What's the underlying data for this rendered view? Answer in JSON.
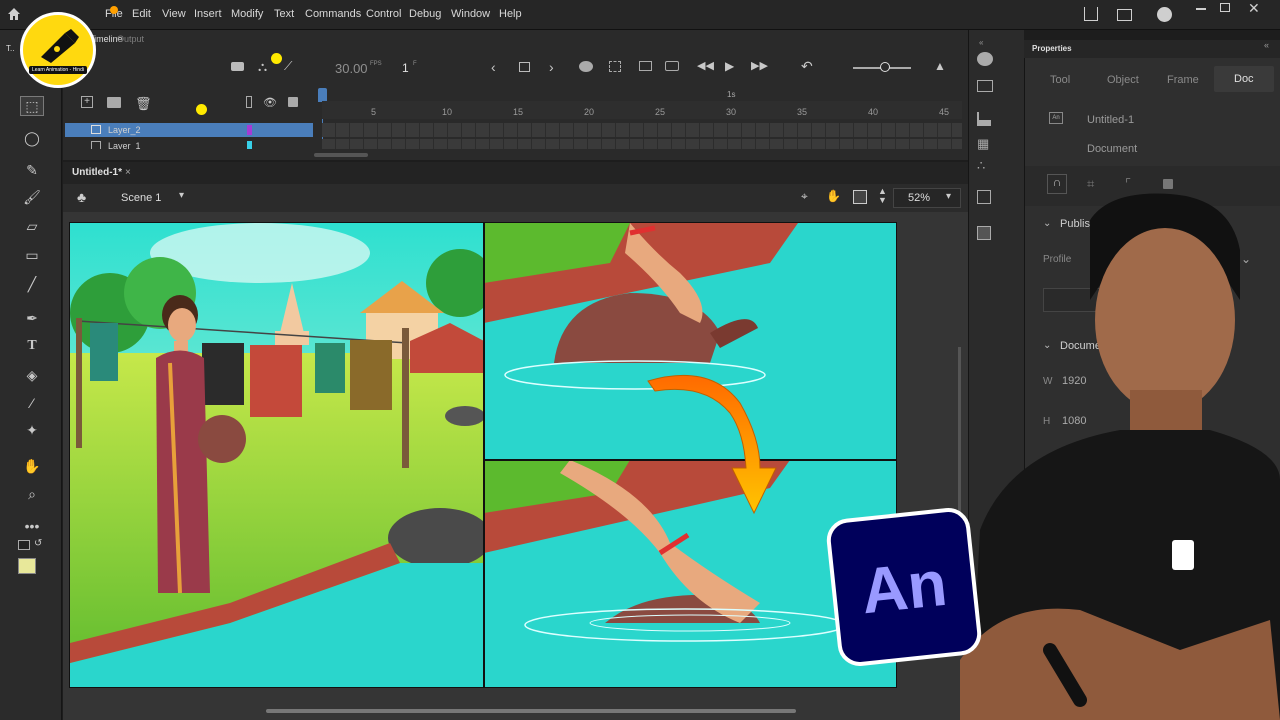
{
  "menu": [
    "File",
    "Edit",
    "View",
    "Insert",
    "Modify",
    "Text",
    "Commands",
    "Control",
    "Debug",
    "Window",
    "Help"
  ],
  "timeline": {
    "tab_timeline": "Timeline",
    "tab_output": "Output",
    "fps": "30.00",
    "fps_unit": "FPS",
    "frame": "1",
    "frame_unit": "F",
    "time_marker": "1s",
    "ticks": [
      "5",
      "10",
      "15",
      "20",
      "25",
      "30",
      "35",
      "40",
      "45"
    ],
    "layers": [
      {
        "name": "Layer_2",
        "color": "#a53bd6",
        "selected": true
      },
      {
        "name": "Layer_1",
        "color": "#38d0e8",
        "selected": false
      }
    ]
  },
  "document": {
    "tab": "Untitled-1*",
    "scene": "Scene 1",
    "zoom": "52%"
  },
  "channel_badge": {
    "text": "Learn Animation - Hindi"
  },
  "properties": {
    "title": "Properties",
    "tabs": [
      "Tool",
      "Object",
      "Frame",
      "Doc"
    ],
    "active_tab": "Doc",
    "doc_name": "Untitled-1",
    "doc_type": "Document",
    "section_publish": "Publish S",
    "profile_label": "Profile",
    "section_document": "Docume",
    "width_label": "W",
    "width_value": "1920",
    "height_label": "H",
    "height_value": "1080"
  },
  "logo": {
    "text": "An",
    "bg": "#00005b",
    "fg": "#9999ff"
  },
  "colors": {
    "accent": "#4a7ebb",
    "stage_water": "#2ad6cc",
    "arrow": "#ff9800"
  }
}
